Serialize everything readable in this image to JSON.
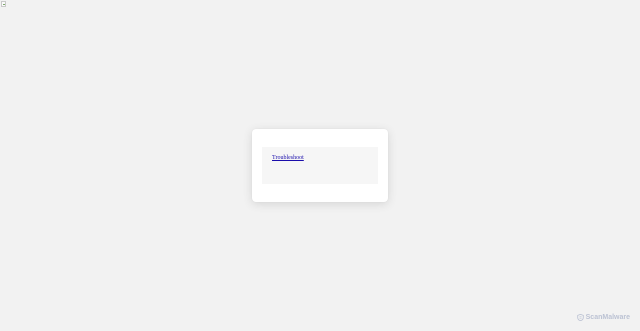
{
  "modal": {
    "link_text": "Troubleshoot"
  },
  "watermark": {
    "text": "ScanMalware",
    "icon": "shield-logo-icon",
    "color": "#b6bdd0"
  },
  "colors": {
    "background": "#f2f2f2",
    "modal": "#ffffff",
    "panel": "#f6f6f6",
    "link": "#1a0dab"
  }
}
